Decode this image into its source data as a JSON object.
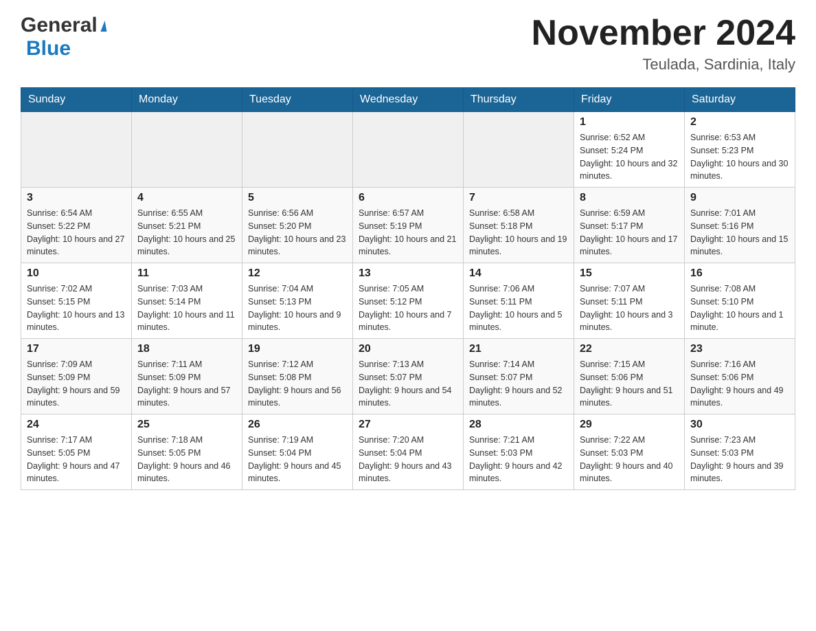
{
  "header": {
    "logo_general": "General",
    "logo_blue": "Blue",
    "title": "November 2024",
    "subtitle": "Teulada, Sardinia, Italy"
  },
  "weekdays": [
    "Sunday",
    "Monday",
    "Tuesday",
    "Wednesday",
    "Thursday",
    "Friday",
    "Saturday"
  ],
  "weeks": [
    [
      {
        "day": "",
        "sunrise": "",
        "sunset": "",
        "daylight": ""
      },
      {
        "day": "",
        "sunrise": "",
        "sunset": "",
        "daylight": ""
      },
      {
        "day": "",
        "sunrise": "",
        "sunset": "",
        "daylight": ""
      },
      {
        "day": "",
        "sunrise": "",
        "sunset": "",
        "daylight": ""
      },
      {
        "day": "",
        "sunrise": "",
        "sunset": "",
        "daylight": ""
      },
      {
        "day": "1",
        "sunrise": "Sunrise: 6:52 AM",
        "sunset": "Sunset: 5:24 PM",
        "daylight": "Daylight: 10 hours and 32 minutes."
      },
      {
        "day": "2",
        "sunrise": "Sunrise: 6:53 AM",
        "sunset": "Sunset: 5:23 PM",
        "daylight": "Daylight: 10 hours and 30 minutes."
      }
    ],
    [
      {
        "day": "3",
        "sunrise": "Sunrise: 6:54 AM",
        "sunset": "Sunset: 5:22 PM",
        "daylight": "Daylight: 10 hours and 27 minutes."
      },
      {
        "day": "4",
        "sunrise": "Sunrise: 6:55 AM",
        "sunset": "Sunset: 5:21 PM",
        "daylight": "Daylight: 10 hours and 25 minutes."
      },
      {
        "day": "5",
        "sunrise": "Sunrise: 6:56 AM",
        "sunset": "Sunset: 5:20 PM",
        "daylight": "Daylight: 10 hours and 23 minutes."
      },
      {
        "day": "6",
        "sunrise": "Sunrise: 6:57 AM",
        "sunset": "Sunset: 5:19 PM",
        "daylight": "Daylight: 10 hours and 21 minutes."
      },
      {
        "day": "7",
        "sunrise": "Sunrise: 6:58 AM",
        "sunset": "Sunset: 5:18 PM",
        "daylight": "Daylight: 10 hours and 19 minutes."
      },
      {
        "day": "8",
        "sunrise": "Sunrise: 6:59 AM",
        "sunset": "Sunset: 5:17 PM",
        "daylight": "Daylight: 10 hours and 17 minutes."
      },
      {
        "day": "9",
        "sunrise": "Sunrise: 7:01 AM",
        "sunset": "Sunset: 5:16 PM",
        "daylight": "Daylight: 10 hours and 15 minutes."
      }
    ],
    [
      {
        "day": "10",
        "sunrise": "Sunrise: 7:02 AM",
        "sunset": "Sunset: 5:15 PM",
        "daylight": "Daylight: 10 hours and 13 minutes."
      },
      {
        "day": "11",
        "sunrise": "Sunrise: 7:03 AM",
        "sunset": "Sunset: 5:14 PM",
        "daylight": "Daylight: 10 hours and 11 minutes."
      },
      {
        "day": "12",
        "sunrise": "Sunrise: 7:04 AM",
        "sunset": "Sunset: 5:13 PM",
        "daylight": "Daylight: 10 hours and 9 minutes."
      },
      {
        "day": "13",
        "sunrise": "Sunrise: 7:05 AM",
        "sunset": "Sunset: 5:12 PM",
        "daylight": "Daylight: 10 hours and 7 minutes."
      },
      {
        "day": "14",
        "sunrise": "Sunrise: 7:06 AM",
        "sunset": "Sunset: 5:11 PM",
        "daylight": "Daylight: 10 hours and 5 minutes."
      },
      {
        "day": "15",
        "sunrise": "Sunrise: 7:07 AM",
        "sunset": "Sunset: 5:11 PM",
        "daylight": "Daylight: 10 hours and 3 minutes."
      },
      {
        "day": "16",
        "sunrise": "Sunrise: 7:08 AM",
        "sunset": "Sunset: 5:10 PM",
        "daylight": "Daylight: 10 hours and 1 minute."
      }
    ],
    [
      {
        "day": "17",
        "sunrise": "Sunrise: 7:09 AM",
        "sunset": "Sunset: 5:09 PM",
        "daylight": "Daylight: 9 hours and 59 minutes."
      },
      {
        "day": "18",
        "sunrise": "Sunrise: 7:11 AM",
        "sunset": "Sunset: 5:09 PM",
        "daylight": "Daylight: 9 hours and 57 minutes."
      },
      {
        "day": "19",
        "sunrise": "Sunrise: 7:12 AM",
        "sunset": "Sunset: 5:08 PM",
        "daylight": "Daylight: 9 hours and 56 minutes."
      },
      {
        "day": "20",
        "sunrise": "Sunrise: 7:13 AM",
        "sunset": "Sunset: 5:07 PM",
        "daylight": "Daylight: 9 hours and 54 minutes."
      },
      {
        "day": "21",
        "sunrise": "Sunrise: 7:14 AM",
        "sunset": "Sunset: 5:07 PM",
        "daylight": "Daylight: 9 hours and 52 minutes."
      },
      {
        "day": "22",
        "sunrise": "Sunrise: 7:15 AM",
        "sunset": "Sunset: 5:06 PM",
        "daylight": "Daylight: 9 hours and 51 minutes."
      },
      {
        "day": "23",
        "sunrise": "Sunrise: 7:16 AM",
        "sunset": "Sunset: 5:06 PM",
        "daylight": "Daylight: 9 hours and 49 minutes."
      }
    ],
    [
      {
        "day": "24",
        "sunrise": "Sunrise: 7:17 AM",
        "sunset": "Sunset: 5:05 PM",
        "daylight": "Daylight: 9 hours and 47 minutes."
      },
      {
        "day": "25",
        "sunrise": "Sunrise: 7:18 AM",
        "sunset": "Sunset: 5:05 PM",
        "daylight": "Daylight: 9 hours and 46 minutes."
      },
      {
        "day": "26",
        "sunrise": "Sunrise: 7:19 AM",
        "sunset": "Sunset: 5:04 PM",
        "daylight": "Daylight: 9 hours and 45 minutes."
      },
      {
        "day": "27",
        "sunrise": "Sunrise: 7:20 AM",
        "sunset": "Sunset: 5:04 PM",
        "daylight": "Daylight: 9 hours and 43 minutes."
      },
      {
        "day": "28",
        "sunrise": "Sunrise: 7:21 AM",
        "sunset": "Sunset: 5:03 PM",
        "daylight": "Daylight: 9 hours and 42 minutes."
      },
      {
        "day": "29",
        "sunrise": "Sunrise: 7:22 AM",
        "sunset": "Sunset: 5:03 PM",
        "daylight": "Daylight: 9 hours and 40 minutes."
      },
      {
        "day": "30",
        "sunrise": "Sunrise: 7:23 AM",
        "sunset": "Sunset: 5:03 PM",
        "daylight": "Daylight: 9 hours and 39 minutes."
      }
    ]
  ]
}
